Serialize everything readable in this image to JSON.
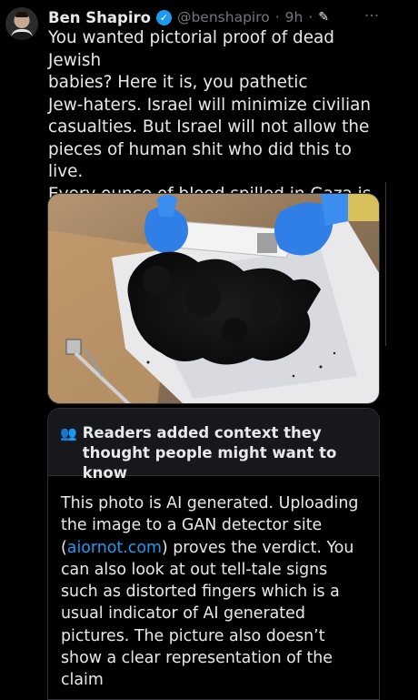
{
  "tweet": {
    "author_name": "Ben Shapiro",
    "handle": "@benshapiro",
    "separator": "·",
    "time": "9h",
    "separator2": "·",
    "text": "You wanted pictorial proof of dead Jewish\nbabies? Here it is, you pathetic\nJew-haters. Israel will minimize civilian\ncasualties. But Israel will not allow the\npieces of human shit who did this to live.\nEvery ounce of blood spilled in Gaza is on\nHamas."
  },
  "icons": {
    "verified": "verified-badge-icon",
    "edit": "edit-pencil-icon",
    "more": "more-dots-icon",
    "readers": "people-icon"
  },
  "community_note": {
    "title": "Readers added context they thought people might want to know",
    "body_before_link": "This photo is AI generated. Uploading the image to a GAN detector site (",
    "link_text": "aiornot.com",
    "body_after_link": ") proves the verdict. You can also look at out tell-tale signs such as distorted fingers which is a usual indicator of AI generated pictures. The picture also doesn’t show a clear representation of the claim"
  },
  "colors": {
    "background": "#000000",
    "text": "#e7e9ea",
    "muted": "#71767b",
    "accent": "#1d9bf0",
    "note_header": "#16181c",
    "border": "#2f3336"
  }
}
